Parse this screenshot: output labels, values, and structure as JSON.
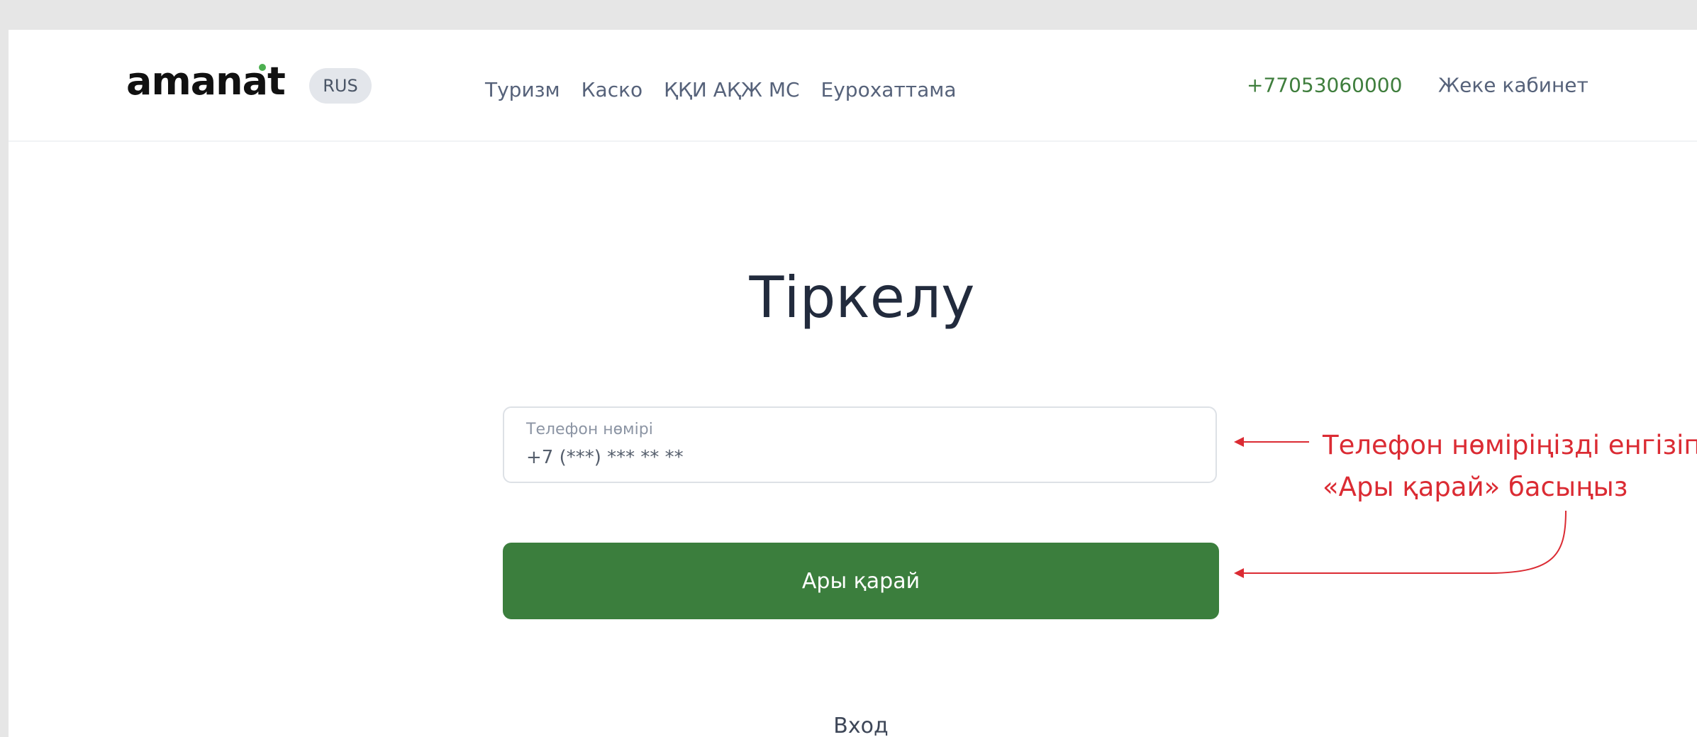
{
  "header": {
    "logo_text": "amanat",
    "lang_label": "RUS",
    "nav": [
      {
        "label": "Туризм"
      },
      {
        "label": "Каско"
      },
      {
        "label": "ҚҚИ АҚЖ МС"
      },
      {
        "label": "Еурохаттама"
      }
    ],
    "phone": "+77053060000",
    "cabinet_label": "Жеке кабинет"
  },
  "main": {
    "title": "Тіркелу",
    "phone_field": {
      "label": "Телефон нөмірі",
      "placeholder": "+7 (***) *** ** **"
    },
    "next_button_label": "Ары қарай",
    "login_link": "Вход"
  },
  "annotation": {
    "line1": "Телефон нөміріңізді енгізіп,",
    "line2": "«Ары қарай» басыңыз"
  },
  "colors": {
    "brand_green": "#3b7e3d",
    "annotation_red": "#db2b33",
    "logo_dot": "#4caf50"
  }
}
